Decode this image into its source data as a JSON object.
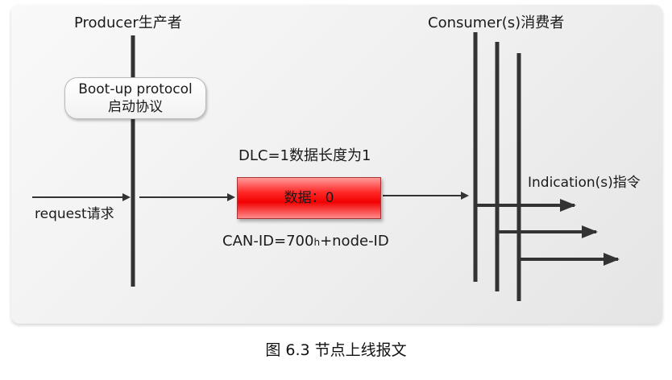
{
  "producer": {
    "title": "Producer生产者",
    "bootup_line1": "Boot-up protocol",
    "bootup_line2": "启动协议",
    "request": "request请求"
  },
  "message": {
    "dlc": "DLC=1数据长度为1",
    "data": "数据：0",
    "can_id_prefix": "CAN-ID=700",
    "can_id_sub": "h",
    "can_id_suffix": "+node-ID"
  },
  "consumer": {
    "title": "Consumer(s)消费者",
    "indication": "Indication(s)指令"
  },
  "caption": "图 6.3 节点上线报文"
}
